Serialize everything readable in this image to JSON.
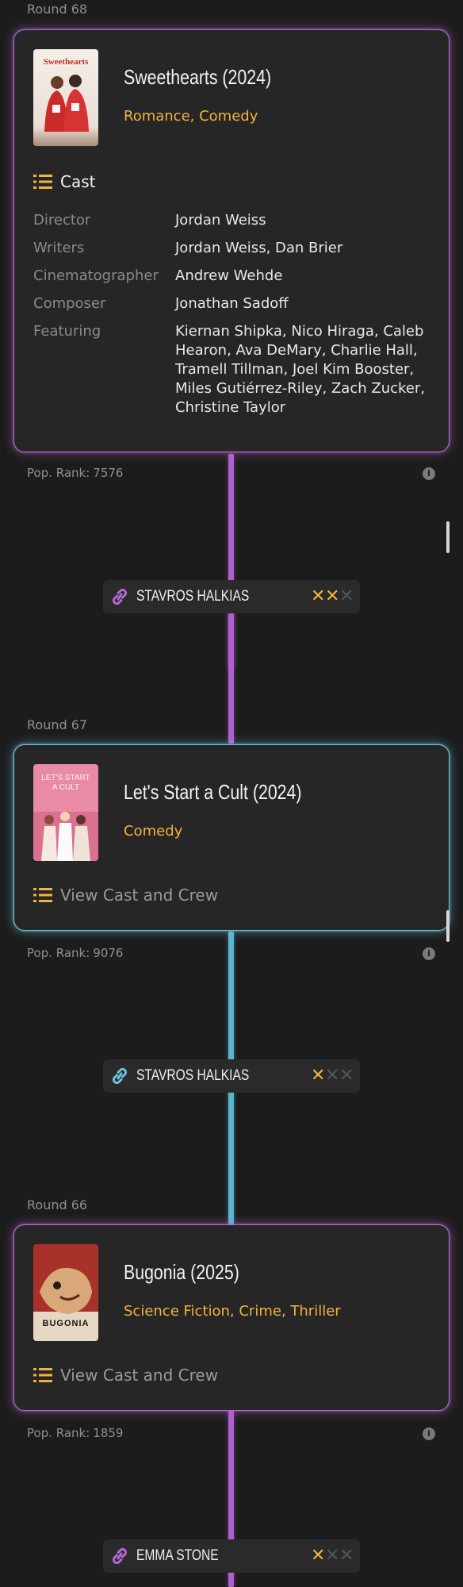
{
  "colors": {
    "accent_gold": "#f2b23e",
    "purple": "#b46ad2",
    "cyan": "#6cc4da",
    "background": "#1c1c1c",
    "card": "#262626"
  },
  "rounds": [
    {
      "round_label": "Round 68",
      "title": "Sweethearts (2024)",
      "genres": "Romance, Comedy",
      "poster_icon": "movie-poster-sweethearts",
      "poster_text": "Sweethearts",
      "cast_label": "Cast",
      "credits": [
        {
          "role": "Director",
          "names": "Jordan Weiss"
        },
        {
          "role": "Writers",
          "names": "Jordan Weiss, Dan Brier"
        },
        {
          "role": "Cinematographer",
          "names": "Andrew Wehde"
        },
        {
          "role": "Composer",
          "names": "Jonathan Sadoff"
        },
        {
          "role": "Featuring",
          "names": "Kiernan Shipka, Nico Hiraga, Caleb Hearon, Ava DeMary, Charlie Hall, Tramell Tillman, Joel Kim Booster, Miles Gutiérrez-Riley, Zach Zucker, Christine Taylor"
        }
      ],
      "pop_rank_label": "Pop. Rank:",
      "pop_rank": "7576",
      "link_person": "STAVROS HALKIAS",
      "strikes_used": 2,
      "strikes_total": 3
    },
    {
      "round_label": "Round 67",
      "title": "Let's Start a Cult (2024)",
      "genres": "Comedy",
      "poster_icon": "movie-poster-lets-start-a-cult",
      "poster_text": "LET'S START A CULT",
      "cast_label": "View Cast and Crew",
      "pop_rank_label": "Pop. Rank:",
      "pop_rank": "9076",
      "link_person": "STAVROS HALKIAS",
      "strikes_used": 1,
      "strikes_total": 3
    },
    {
      "round_label": "Round 66",
      "title": "Bugonia (2025)",
      "genres": "Science Fiction, Crime, Thriller",
      "poster_icon": "movie-poster-bugonia",
      "poster_text": "BUGONIA",
      "cast_label": "View Cast and Crew",
      "pop_rank_label": "Pop. Rank:",
      "pop_rank": "1859",
      "link_person": "EMMA STONE",
      "strikes_used": 1,
      "strikes_total": 3
    }
  ],
  "strike_glyph": "✕",
  "info_glyph": "i"
}
